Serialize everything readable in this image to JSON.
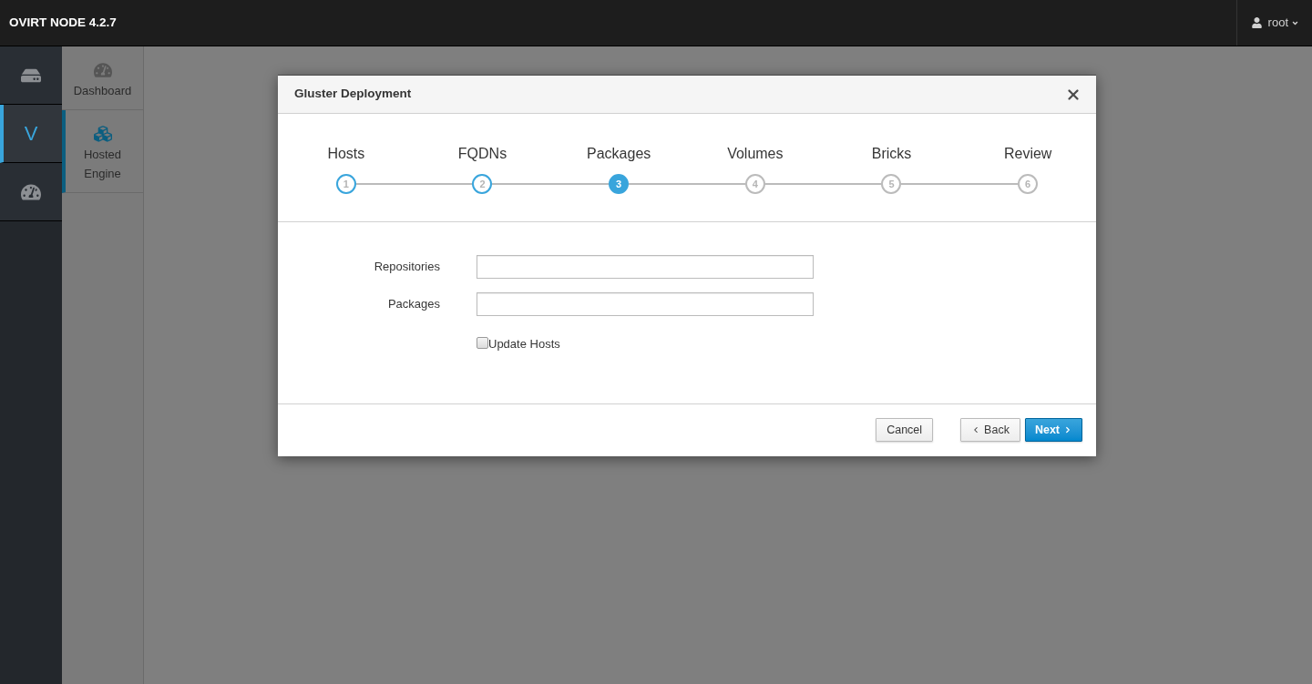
{
  "top_bar": {
    "brand": "OVIRT NODE 4.2.7",
    "user_menu": {
      "label": "root"
    }
  },
  "primary_nav": {
    "items": [
      {
        "kind": "drive",
        "selected": false
      },
      {
        "kind": "letter",
        "label": "V",
        "selected": true
      },
      {
        "kind": "gauge",
        "selected": false
      }
    ]
  },
  "secondary_nav": {
    "items": [
      {
        "kind": "gauge",
        "label": "Dashboard",
        "selected": false
      },
      {
        "kind": "cubes",
        "label": "Hosted Engine",
        "selected": true
      }
    ]
  },
  "dialog": {
    "title": "Gluster Deployment",
    "steps": [
      {
        "label": "Hosts",
        "number": "1",
        "selected": false,
        "completed": true
      },
      {
        "label": "FQDNs",
        "number": "2",
        "selected": false,
        "completed": true
      },
      {
        "label": "Packages",
        "number": "3",
        "selected": true,
        "completed": false
      },
      {
        "label": "Volumes",
        "number": "4",
        "selected": false,
        "completed": false
      },
      {
        "label": "Bricks",
        "number": "5",
        "selected": false,
        "completed": false
      },
      {
        "label": "Review",
        "number": "6",
        "selected": false,
        "completed": false
      }
    ],
    "fields": [
      {
        "label": "Repositories"
      },
      {
        "label": "Packages"
      }
    ],
    "checkbox": {
      "label": "Update Hosts",
      "checked": false
    },
    "buttons": [
      {
        "kind": "plain",
        "label": "Cancel"
      },
      {
        "kind": "back",
        "label": "Back"
      },
      {
        "kind": "next",
        "label": "Next"
      }
    ]
  }
}
